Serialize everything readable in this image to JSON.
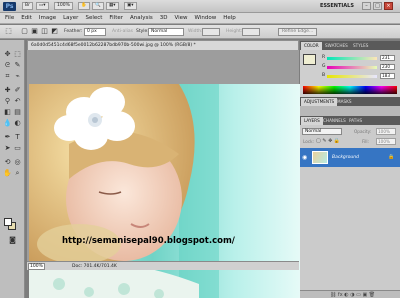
{
  "app": {
    "logo": "Ps",
    "zoom": "100%",
    "workspace": "ESSENTIALS",
    "window_buttons": [
      "–",
      "□",
      "×"
    ]
  },
  "menu": [
    "File",
    "Edit",
    "Image",
    "Layer",
    "Select",
    "Filter",
    "Analysis",
    "3D",
    "View",
    "Window",
    "Help"
  ],
  "options": {
    "feather_label": "Feather:",
    "feather_value": "0 px",
    "antialias_label": "Anti-alias",
    "style_label": "Style:",
    "style_value": "Normal",
    "width_label": "Width:",
    "height_label": "Height:",
    "refine_edge": "Refine Edge..."
  },
  "document": {
    "tab_title": "6a0d0d5451c4d68f5e0012b62287bdb970b-500wi.jpg @ 100% (RGB/8) *",
    "zoom": "100%",
    "doc_size": "Doc: 701.4K/701.4K",
    "watermark": "http://semanisepal90.blogspot.com/"
  },
  "panels": {
    "color_tabs": [
      "COLOR",
      "SWATCHES",
      "STYLES"
    ],
    "color": {
      "fg_hex": "#efeed2",
      "channels": [
        {
          "label": "R",
          "value": "231"
        },
        {
          "label": "G",
          "value": "230"
        },
        {
          "label": "B",
          "value": "183"
        }
      ]
    },
    "adjust_tabs": [
      "ADJUSTMENTS",
      "MASKS"
    ],
    "layer_tabs": [
      "LAYERS",
      "CHANNELS",
      "PATHS"
    ],
    "layers": {
      "blend_mode": "Normal",
      "opacity_label": "Opacity:",
      "opacity_value": "100%",
      "lock_label": "Lock:",
      "fill_label": "Fill:",
      "fill_value": "100%",
      "items": [
        {
          "name": "Background",
          "visible": true,
          "locked": true
        }
      ]
    }
  }
}
